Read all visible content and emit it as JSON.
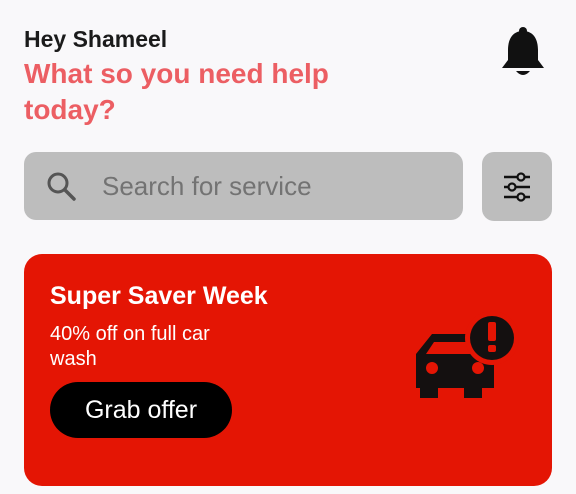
{
  "header": {
    "greeting": "Hey Shameel",
    "headline": "What so you need help today?",
    "notification_icon": "bell-icon"
  },
  "search": {
    "placeholder": "Search for service",
    "value": "",
    "icon": "search-icon"
  },
  "filter": {
    "icon": "sliders-icon"
  },
  "promo": {
    "title": "Super Saver Week",
    "description": "40% off on full car wash",
    "button_label": "Grab offer",
    "icon": "car-alert-icon",
    "background_color": "#e41504"
  },
  "colors": {
    "accent": "#ec5e63",
    "field_background": "#bdbdbd"
  }
}
